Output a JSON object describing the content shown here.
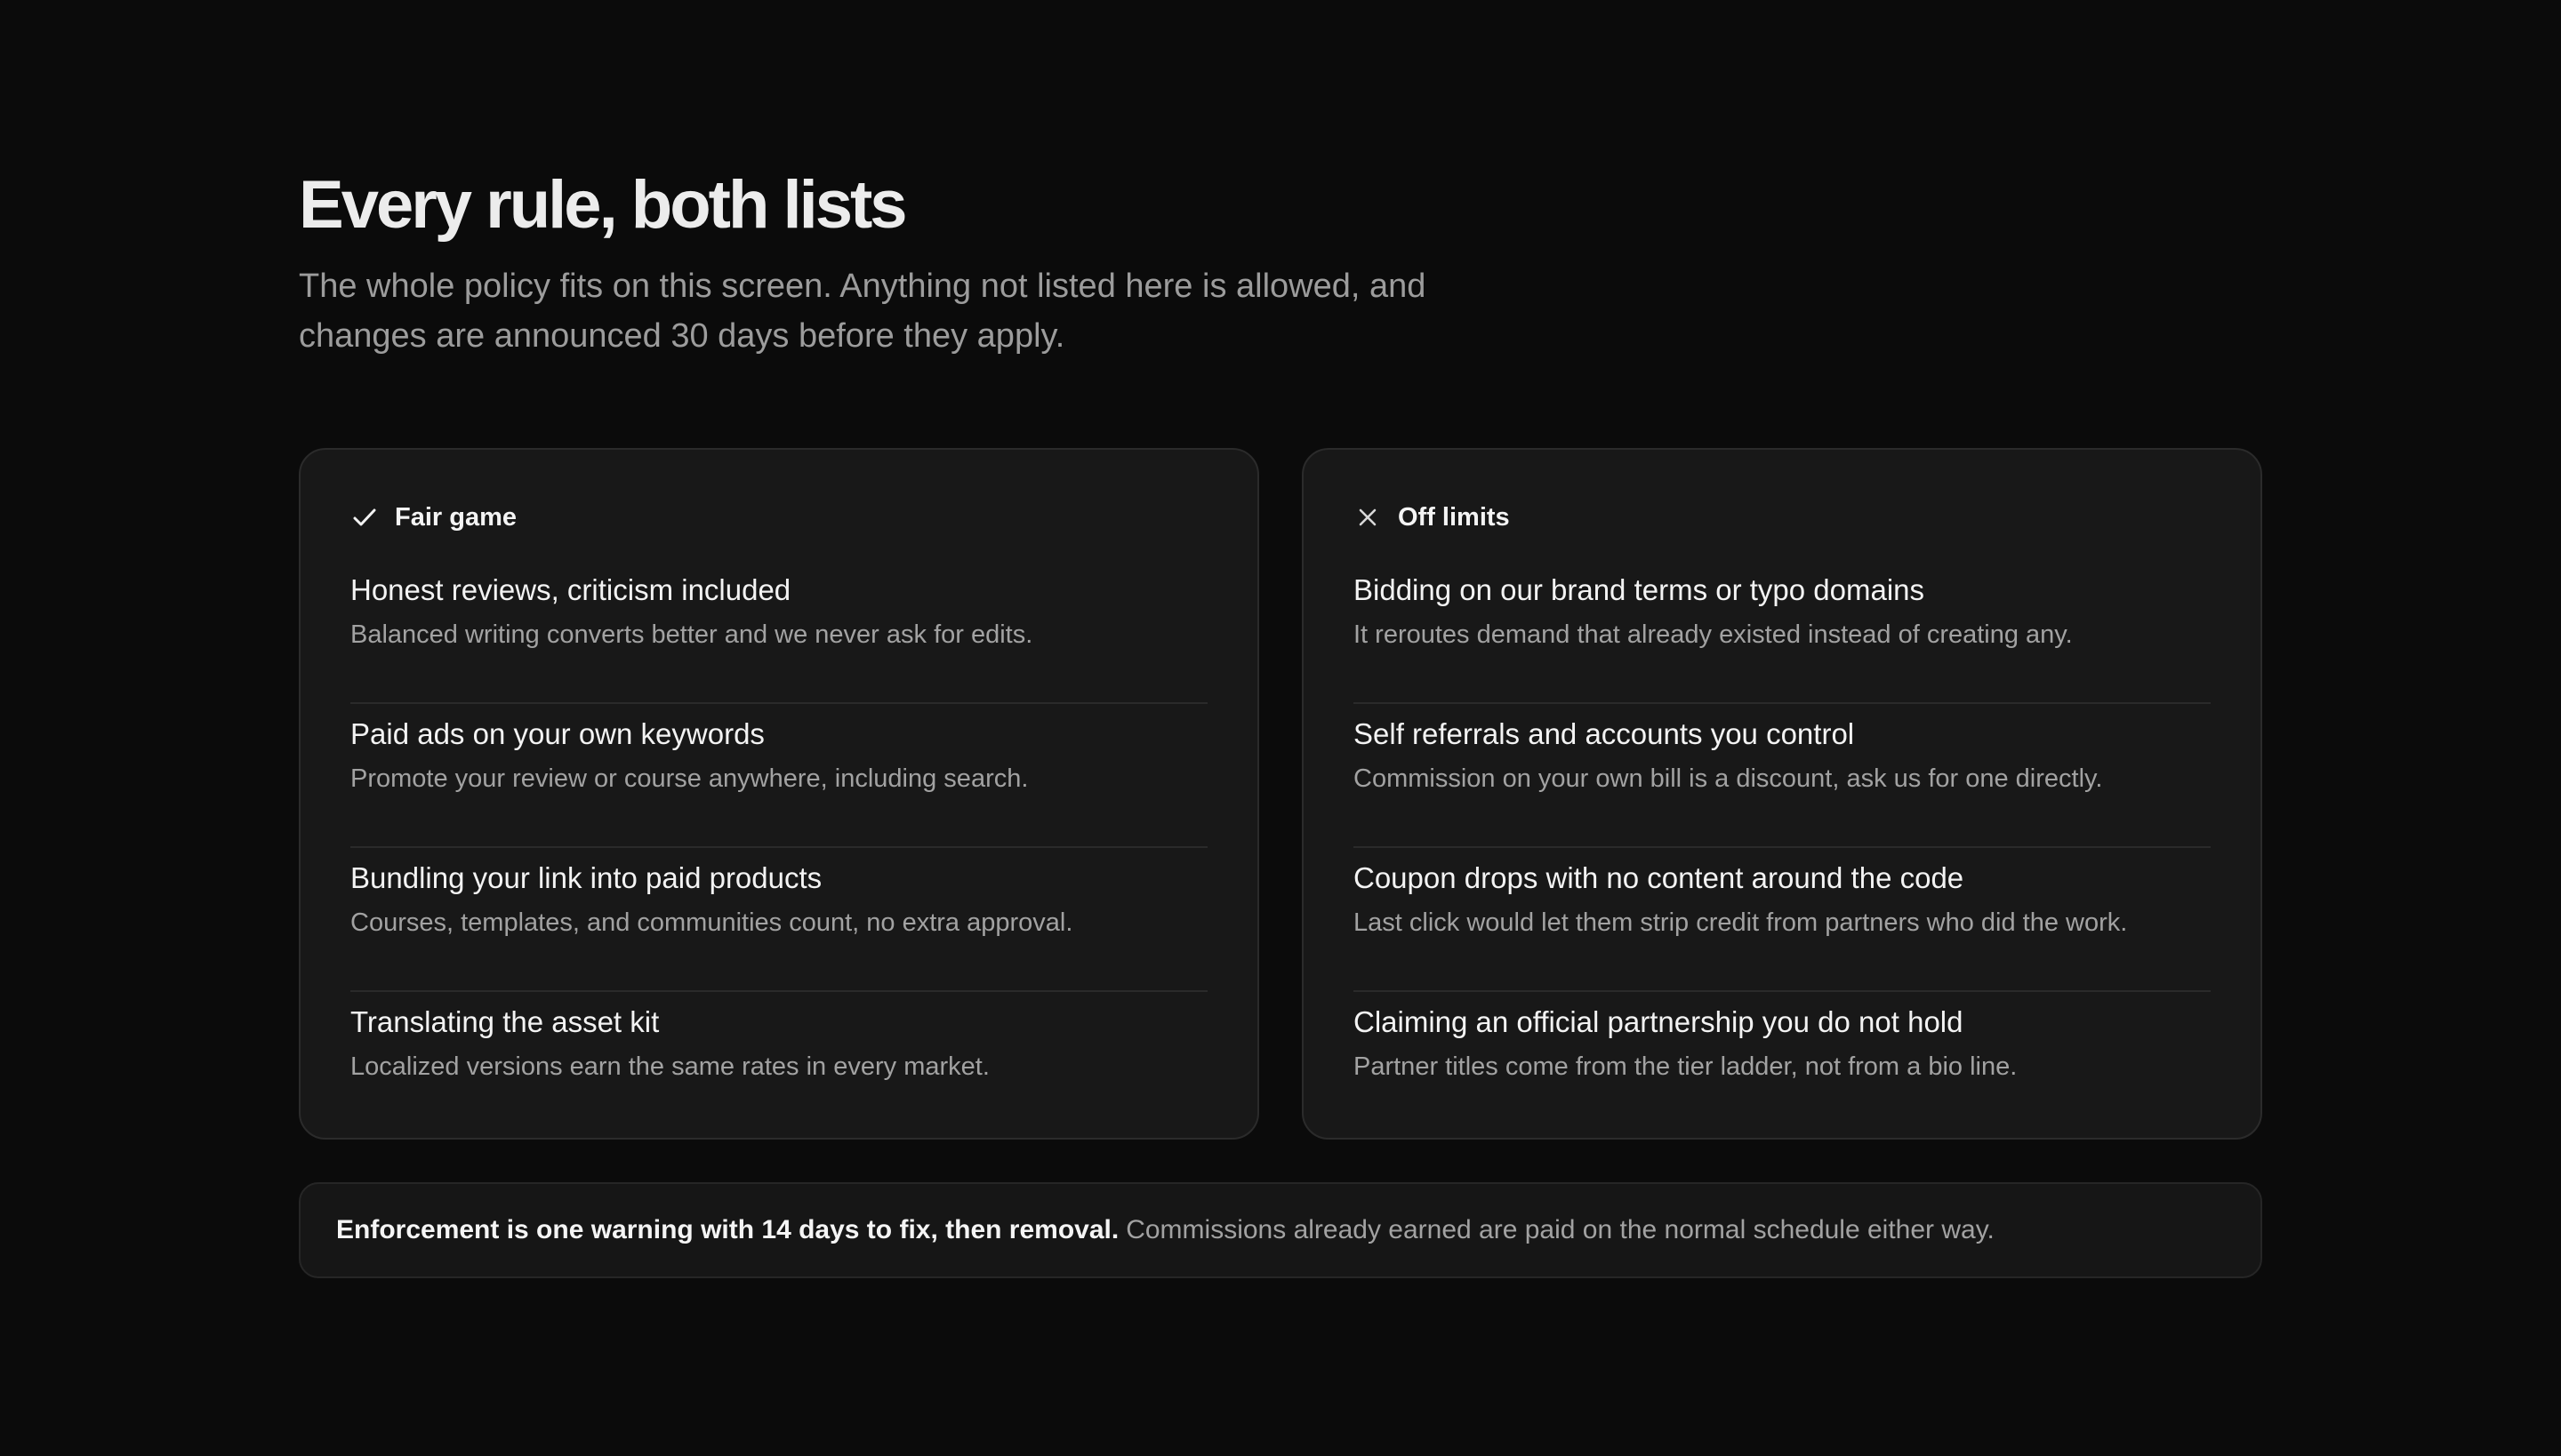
{
  "header": {
    "title": "Every rule, both lists",
    "subtitle": "The whole policy fits on this screen. Anything not listed here is allowed, and changes are announced 30 days before they apply."
  },
  "cards": [
    {
      "icon": "check-icon",
      "title": "Fair game",
      "rules": [
        {
          "title": "Honest reviews, criticism included",
          "desc": "Balanced writing converts better and we never ask for edits."
        },
        {
          "title": "Paid ads on your own keywords",
          "desc": "Promote your review or course anywhere, including search."
        },
        {
          "title": "Bundling your link into paid products",
          "desc": "Courses, templates, and communities count, no extra approval."
        },
        {
          "title": "Translating the asset kit",
          "desc": "Localized versions earn the same rates in every market."
        }
      ]
    },
    {
      "icon": "x-icon",
      "title": "Off limits",
      "rules": [
        {
          "title": "Bidding on our brand terms or typo domains",
          "desc": "It reroutes demand that already existed instead of creating any."
        },
        {
          "title": "Self referrals and accounts you control",
          "desc": "Commission on your own bill is a discount, ask us for one directly."
        },
        {
          "title": "Coupon drops with no content around the code",
          "desc": "Last click would let them strip credit from partners who did the work."
        },
        {
          "title": "Claiming an official partnership you do not hold",
          "desc": "Partner titles come from the tier ladder, not from a bio line."
        }
      ]
    }
  ],
  "enforcement": {
    "strong": "Enforcement is one warning with 14 days to fix, then removal.",
    "rest": "Commissions already earned are paid on the normal schedule either way."
  }
}
